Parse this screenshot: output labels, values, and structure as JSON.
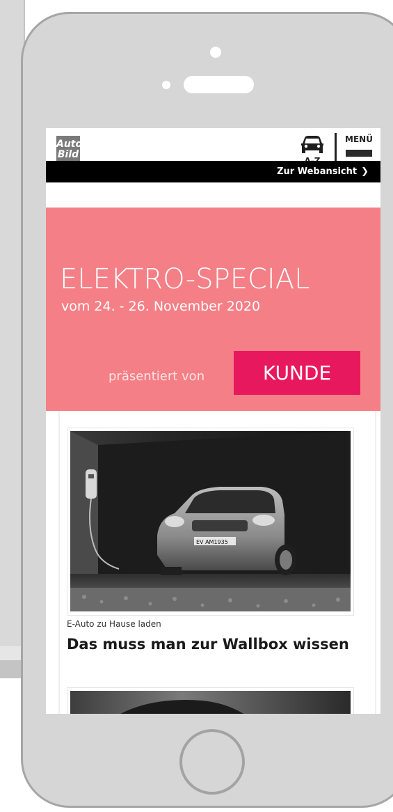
{
  "header": {
    "logo_line1": "Auto",
    "logo_line2": "Bild",
    "az_label": "A-Z",
    "menu_label": "MENÜ"
  },
  "webview": {
    "link_label": "Zur Webansicht",
    "chevron": "❯"
  },
  "hero": {
    "title": "ELEKTRO-SPECIAL",
    "subtitle": "vom 24. - 26. November 2020",
    "presented_by": "präsentiert von",
    "sponsor": "KUNDE"
  },
  "article": {
    "kicker": "E-Auto zu Hause laden",
    "title": "Das muss man zur Wallbox wissen",
    "image_desc": "car-in-garage-with-wallbox"
  },
  "icons": {
    "car": "car-icon",
    "menu": "hamburger-icon",
    "chevron": "chevron-right-icon"
  },
  "colors": {
    "hero_bg": "#f57f86",
    "sponsor_bg": "#e8185e",
    "webview_bg": "#000000",
    "phone_body": "#d6d6d6"
  }
}
